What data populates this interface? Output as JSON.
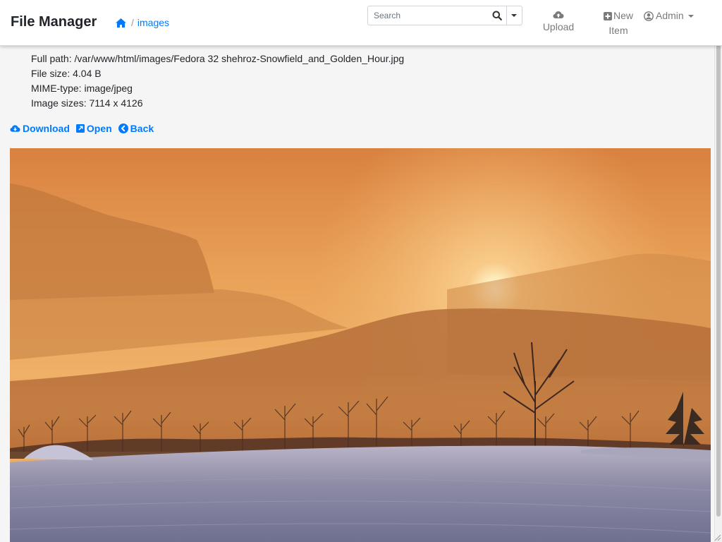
{
  "app": {
    "title": "File Manager"
  },
  "breadcrumb": {
    "home_icon": "home-icon",
    "separator": "/",
    "current": "images"
  },
  "search": {
    "placeholder": "Search",
    "value": ""
  },
  "nav": {
    "upload": {
      "label": "Upload",
      "icon": "cloud-upload-icon"
    },
    "new_item": {
      "line1": "New",
      "line2": "Item",
      "icon": "plus-square-icon"
    },
    "admin": {
      "label": "Admin",
      "icon": "user-circle-icon"
    }
  },
  "file_info": {
    "full_path": "Full path: /var/www/html/images/Fedora 32 shehroz-Snowfield_and_Golden_Hour.jpg",
    "file_size": "File size: 4.04 B",
    "mime_type": "MIME-type: image/jpeg",
    "image_sizes": "Image sizes: 7114 x 4126"
  },
  "actions": {
    "download": "Download",
    "open": "Open",
    "back": "Back"
  },
  "colors": {
    "link": "#007bff",
    "nav_text": "#7a7a7a",
    "background": "#f5f5f5"
  }
}
